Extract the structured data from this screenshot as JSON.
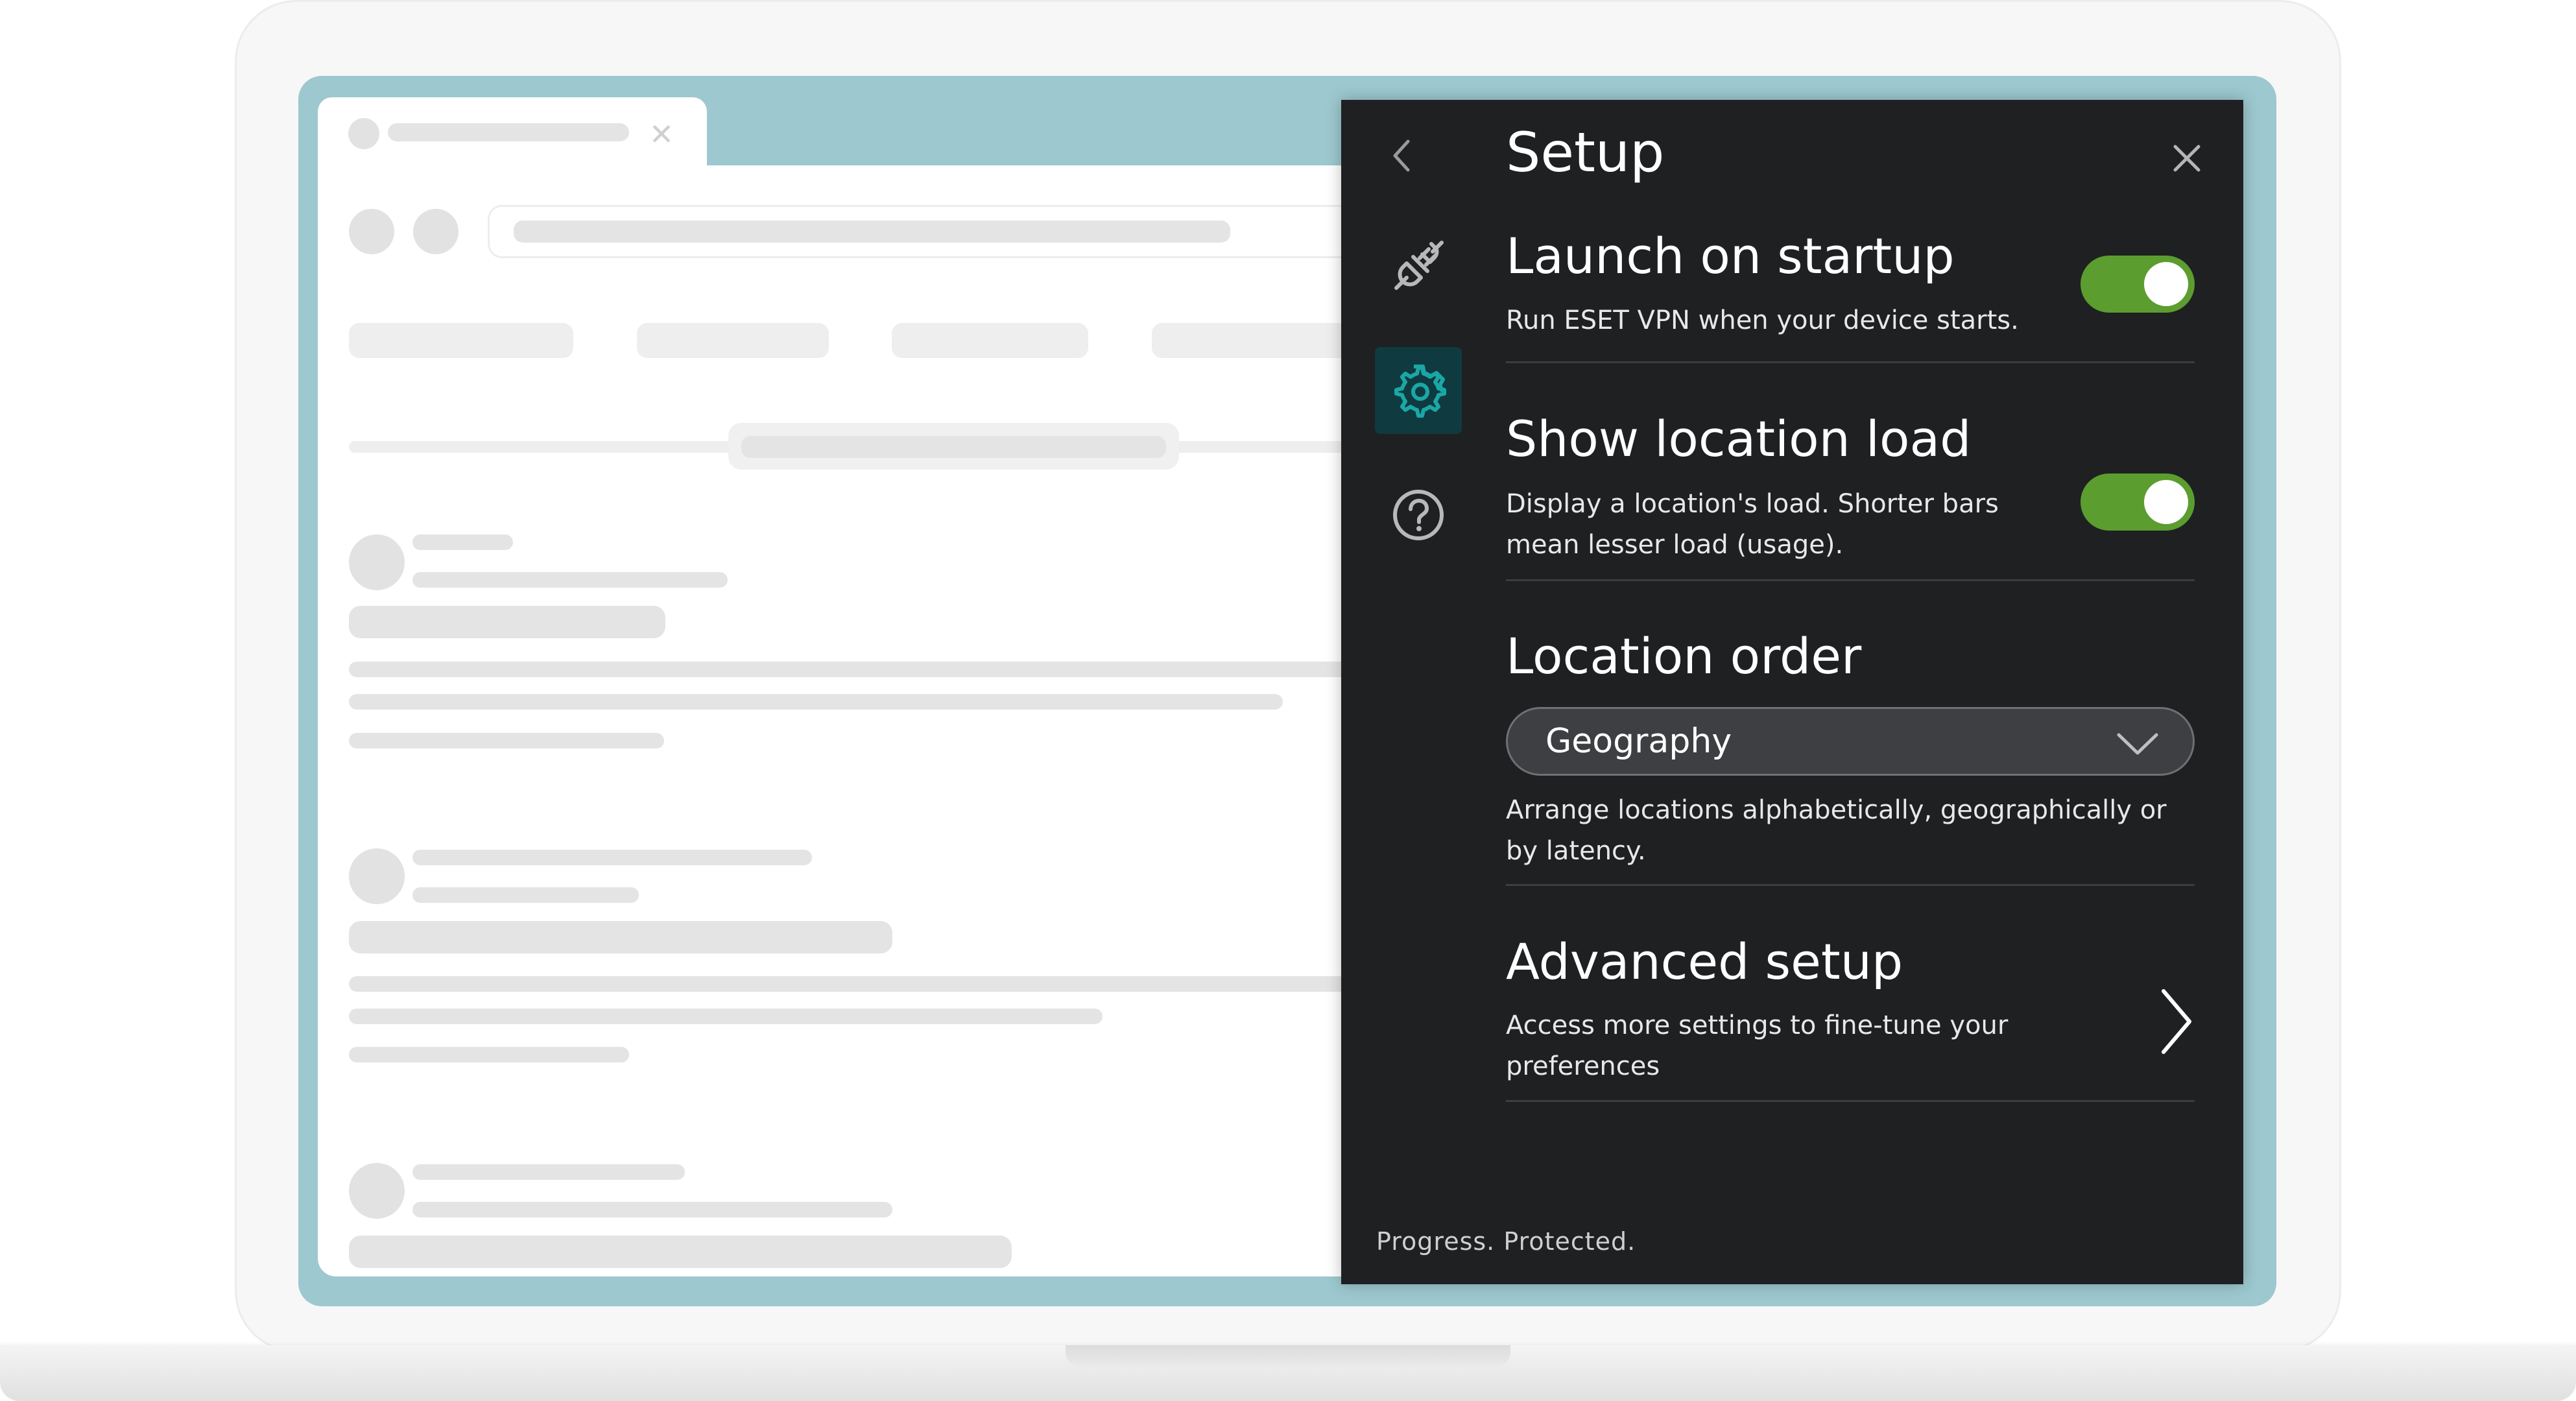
{
  "panel": {
    "title": "Setup",
    "footer": "Progress. Protected."
  },
  "rail": {
    "items": [
      {
        "icon": "plug-icon",
        "active": false
      },
      {
        "icon": "gear-icon",
        "active": true
      },
      {
        "icon": "help-icon",
        "active": false
      }
    ]
  },
  "settings": {
    "launch_on_startup": {
      "title": "Launch on startup",
      "description": "Run ESET VPN when your device starts.",
      "enabled": true
    },
    "show_location_load": {
      "title": "Show location load",
      "description": "Display a location's load. Shorter bars mean lesser load (usage).",
      "enabled": true
    },
    "location_order": {
      "title": "Location order",
      "selected": "Geography",
      "description": "Arrange locations alphabetically, geographically or by latency."
    },
    "advanced_setup": {
      "title": "Advanced setup",
      "description": "Access more settings to fine-tune your preferences"
    }
  },
  "colors": {
    "panel_bg": "#1f2022",
    "toggle_on": "#5b9d2e",
    "accent": "#1aa7a6",
    "screen_bg": "#9dc8cf"
  }
}
